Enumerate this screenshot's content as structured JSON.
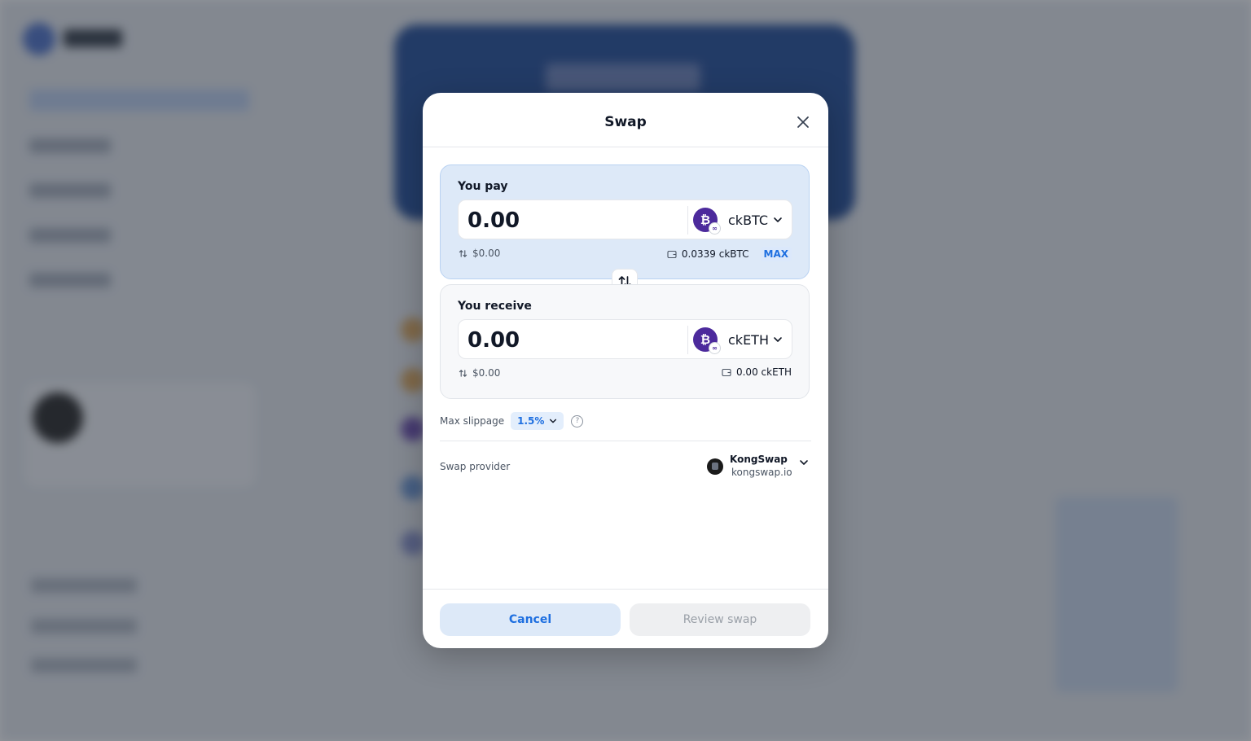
{
  "modal": {
    "title": "Swap",
    "close_icon": "close-icon"
  },
  "pay": {
    "label": "You pay",
    "amount": "0.00",
    "token": "ckBTC",
    "token_icon": "bitcoin-icon",
    "usd_value": "$0.00",
    "balance": "0.0339 ckBTC",
    "max_label": "MAX"
  },
  "receive": {
    "label": "You receive",
    "amount": "0.00",
    "token": "ckETH",
    "token_icon": "bitcoin-icon",
    "usd_value": "$0.00",
    "balance": "0.00 ckETH"
  },
  "slippage": {
    "label": "Max slippage",
    "value": "1.5%"
  },
  "provider": {
    "label": "Swap provider",
    "name": "KongSwap",
    "url": "kongswap.io"
  },
  "footer": {
    "cancel_label": "Cancel",
    "review_label": "Review swap"
  },
  "colors": {
    "accent": "#1e6fe0",
    "pay_panel_bg": "#dde9f8",
    "token_logo_bg": "#4c2a9c",
    "overlay": "rgba(55,60,70,0.55)"
  }
}
